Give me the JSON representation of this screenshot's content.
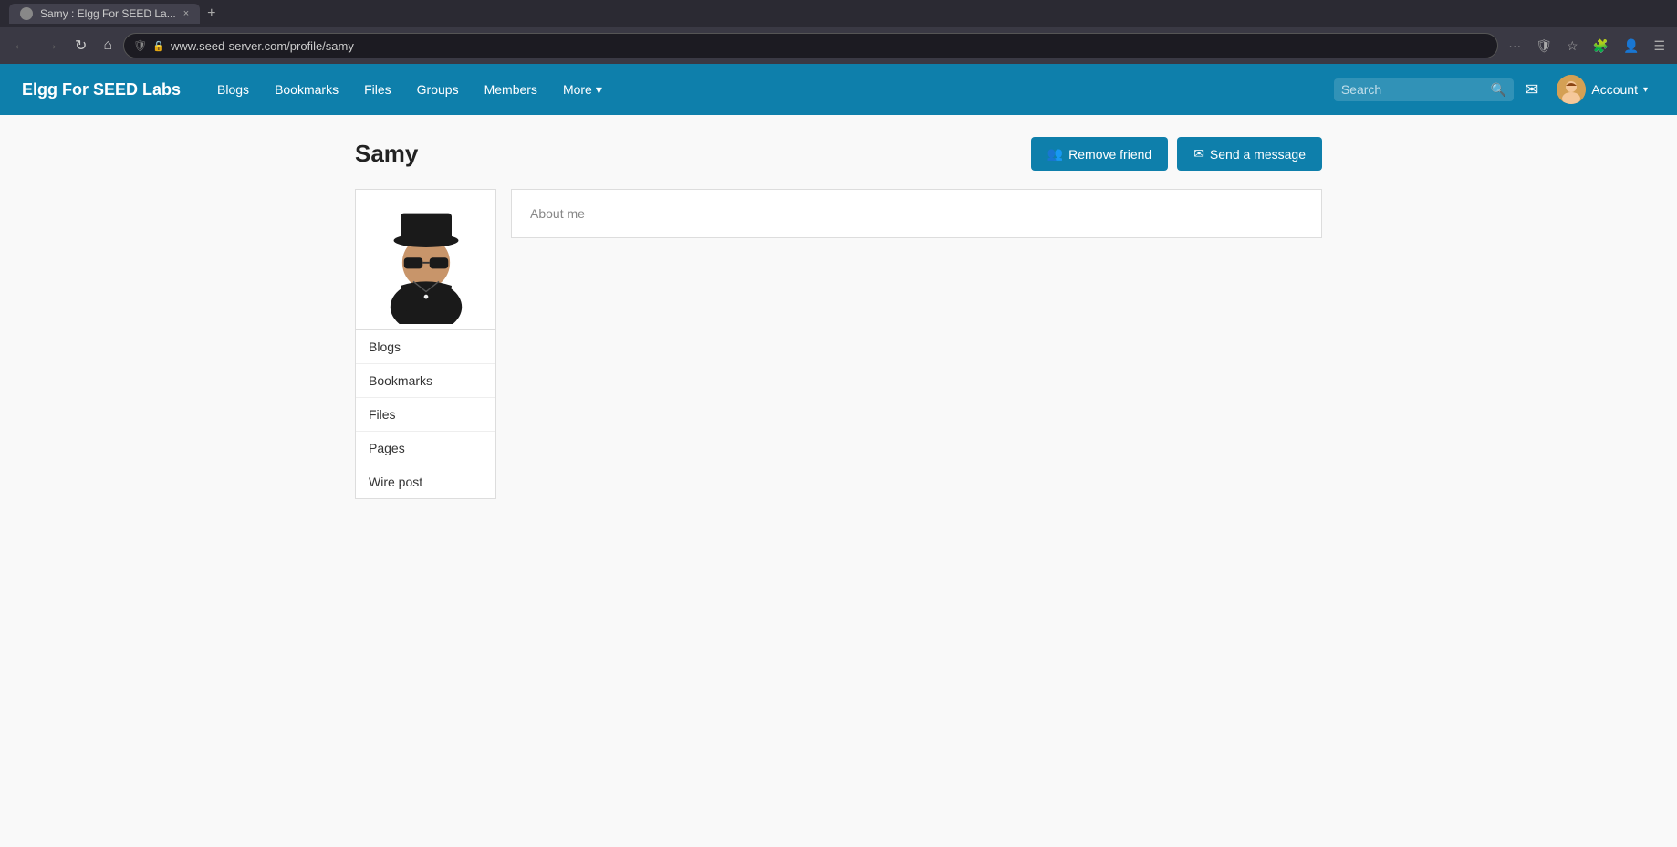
{
  "browser": {
    "tab_title": "Samy : Elgg For SEED La...",
    "tab_favicon": "🌐",
    "close_label": "×",
    "new_tab_label": "+",
    "url": "www.seed-server.com/profile/samy",
    "back_btn": "←",
    "forward_btn": "→",
    "refresh_btn": "↻",
    "home_btn": "⌂"
  },
  "navbar": {
    "brand": "Elgg For SEED Labs",
    "links": [
      {
        "label": "Blogs",
        "id": "blogs"
      },
      {
        "label": "Bookmarks",
        "id": "bookmarks"
      },
      {
        "label": "Files",
        "id": "files"
      },
      {
        "label": "Groups",
        "id": "groups"
      },
      {
        "label": "Members",
        "id": "members"
      },
      {
        "label": "More",
        "id": "more",
        "has_dropdown": true
      }
    ],
    "search_placeholder": "Search",
    "account_label": "Account"
  },
  "profile": {
    "name": "Samy",
    "remove_friend_label": "Remove friend",
    "send_message_label": "Send a message",
    "sidebar_links": [
      {
        "label": "Blogs",
        "id": "blogs"
      },
      {
        "label": "Bookmarks",
        "id": "bookmarks"
      },
      {
        "label": "Files",
        "id": "files"
      },
      {
        "label": "Pages",
        "id": "pages"
      },
      {
        "label": "Wire post",
        "id": "wire-post"
      }
    ],
    "about_me_label": "About me"
  },
  "colors": {
    "navbar_bg": "#0e7fab",
    "btn_primary": "#0e7fab"
  }
}
